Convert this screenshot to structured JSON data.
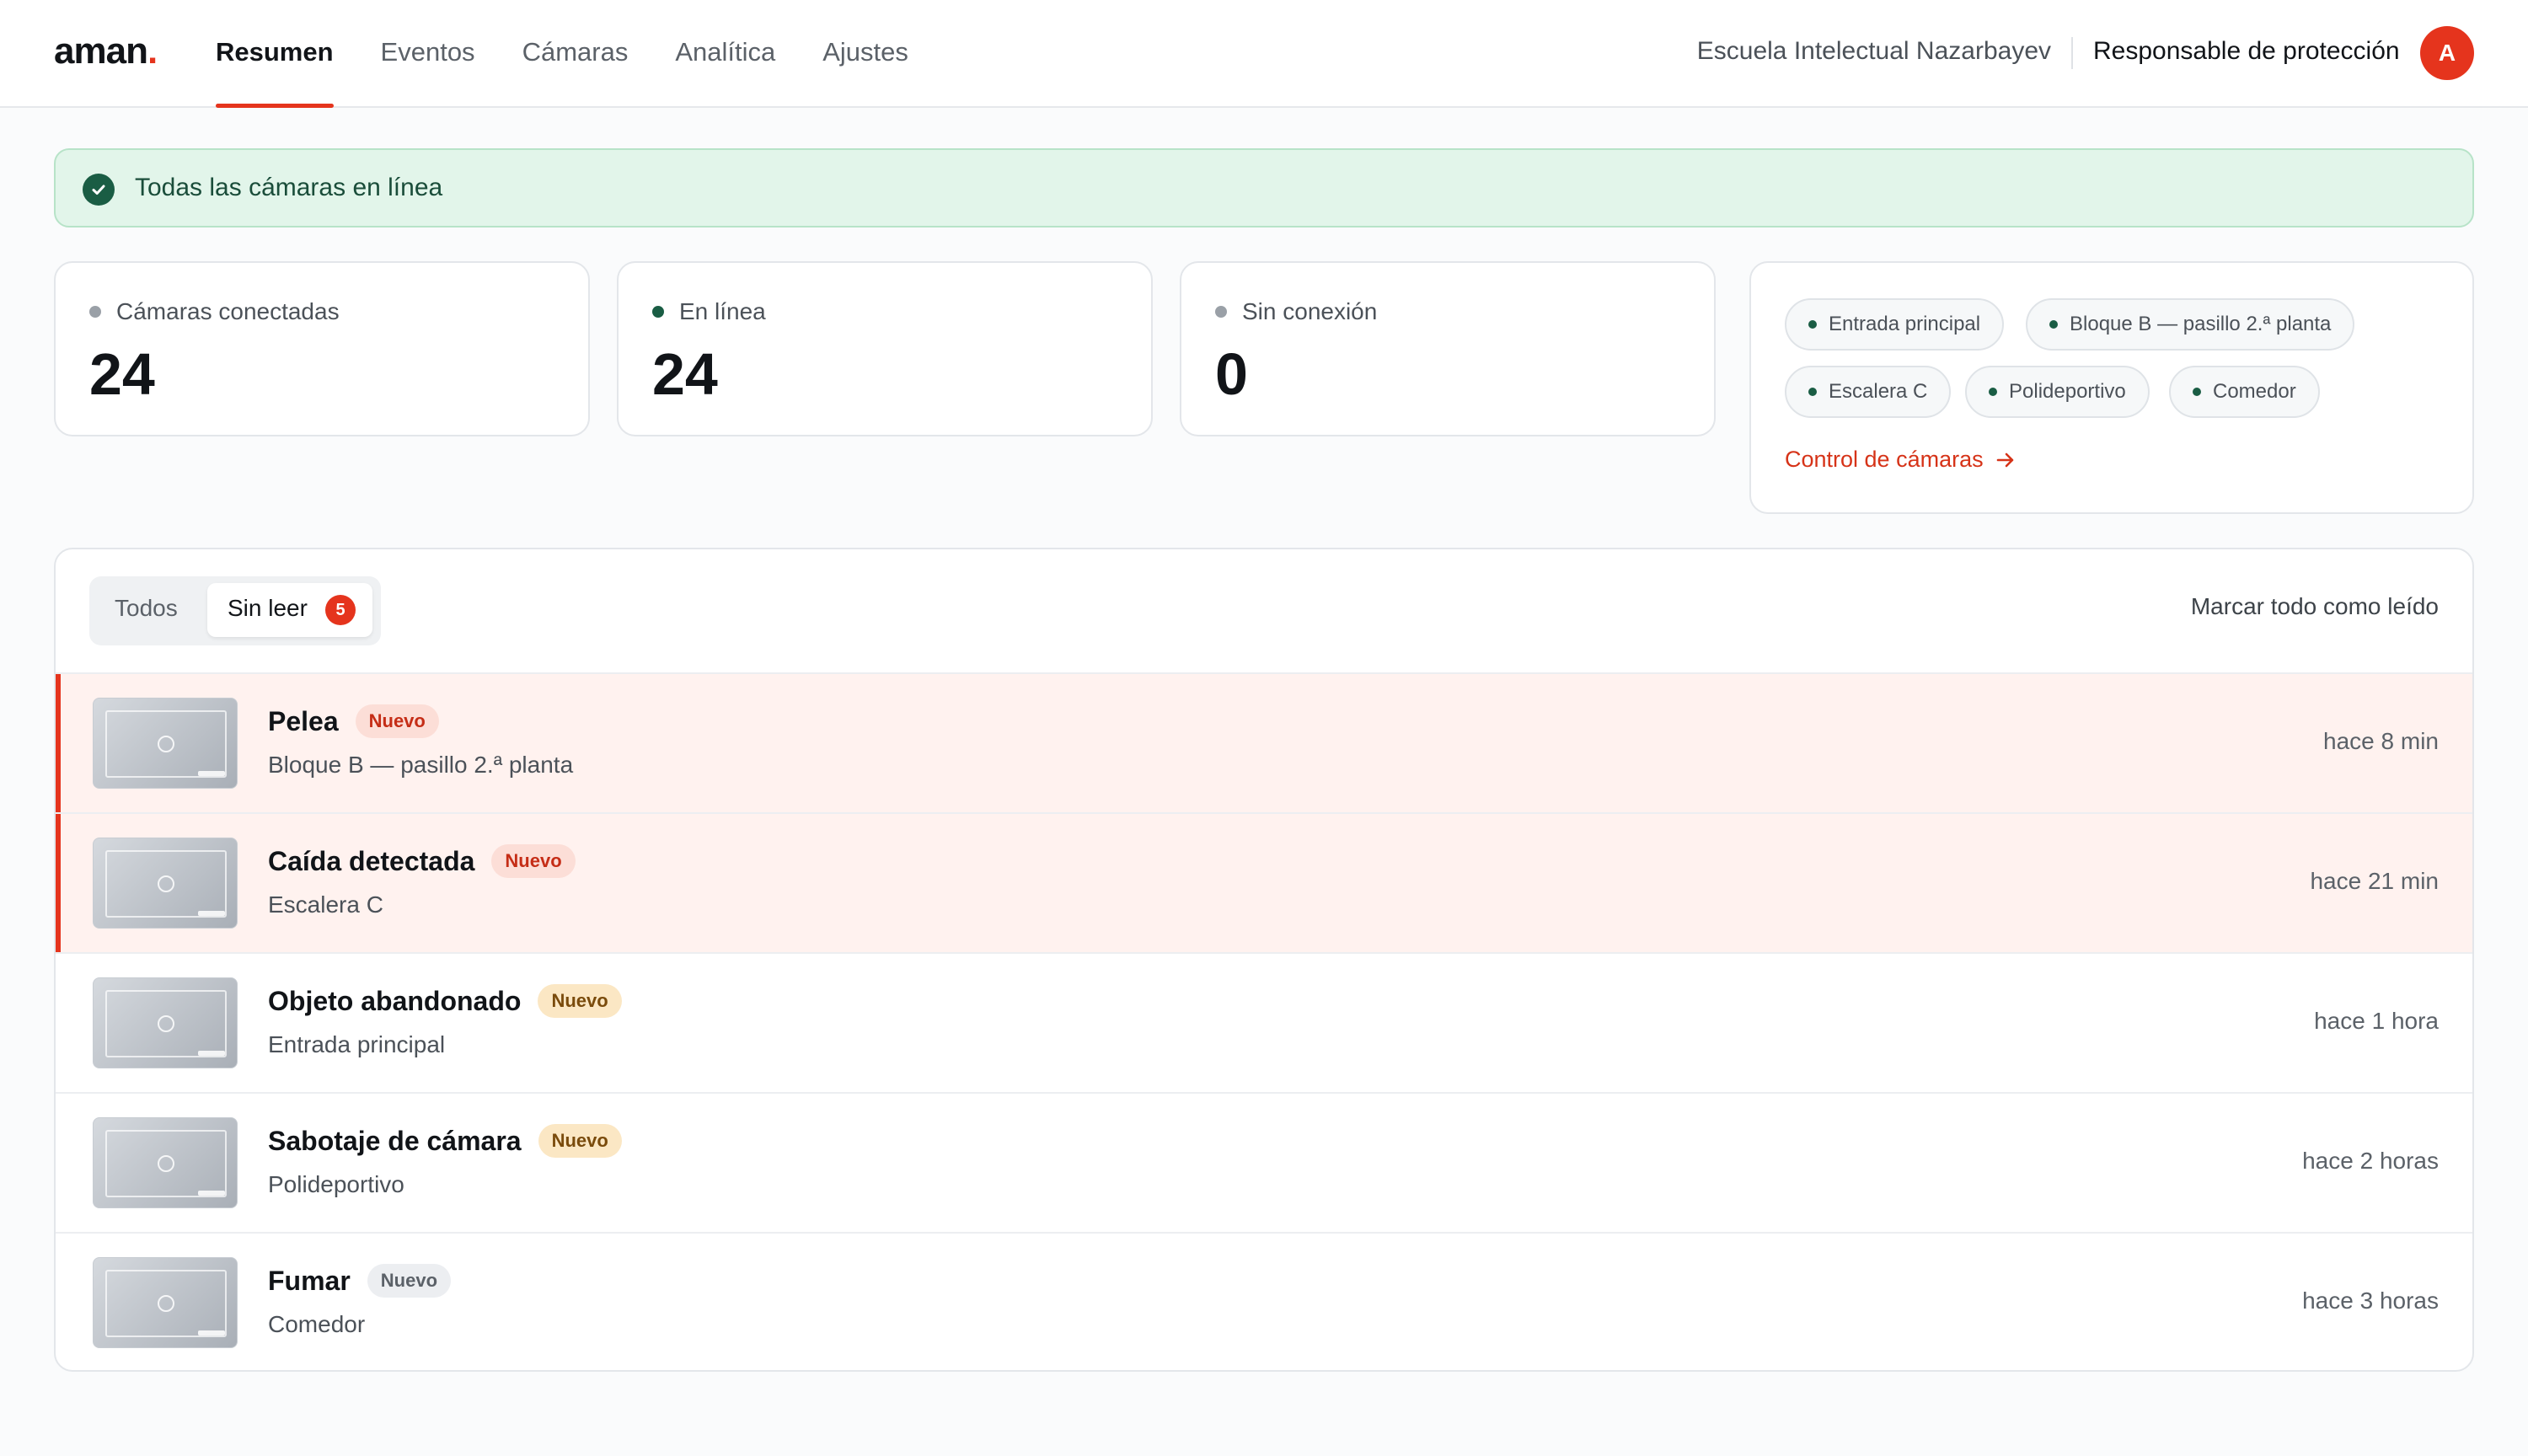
{
  "header": {
    "logo": "aman",
    "logo_dot": ".",
    "nav": [
      "Resumen",
      "Eventos",
      "Cámaras",
      "Analítica",
      "Ajustes"
    ],
    "active_nav": "Resumen",
    "organization": "Escuela Intelectual Nazarbayev",
    "role": "Responsable de protección",
    "avatar_letter": "A"
  },
  "banner": {
    "text": "Todas las cámaras en línea"
  },
  "stats": [
    {
      "label": "Cámaras conectadas",
      "value": "24",
      "dot_color": "#9aa0a7"
    },
    {
      "label": "En línea",
      "value": "24",
      "dot_color": "#1a5d44"
    },
    {
      "label": "Sin conexión",
      "value": "0",
      "dot_color": "#9aa0a7"
    }
  ],
  "cameras": {
    "chips": [
      "Entrada principal",
      "Bloque B — pasillo 2.ª planta",
      "Escalera C",
      "Polideportivo",
      "Comedor"
    ],
    "link": "Control de cámaras"
  },
  "events": {
    "tab_all": "Todos",
    "tab_unread": "Sin leer",
    "unread_count": "5",
    "mark_all": "Marcar todo como leído",
    "items": [
      {
        "title": "Pelea",
        "tag": "Nuevo",
        "tag_style": "red",
        "location": "Bloque B — pasillo 2.ª planta",
        "time": "hace 8 min",
        "highlight": true
      },
      {
        "title": "Caída detectada",
        "tag": "Nuevo",
        "tag_style": "red",
        "location": "Escalera C",
        "time": "hace 21 min",
        "highlight": true
      },
      {
        "title": "Objeto abandonado",
        "tag": "Nuevo",
        "tag_style": "amber",
        "location": "Entrada principal",
        "time": "hace 1 hora",
        "highlight": false
      },
      {
        "title": "Sabotaje de cámara",
        "tag": "Nuevo",
        "tag_style": "amber",
        "location": "Polideportivo",
        "time": "hace 2 horas",
        "highlight": false
      },
      {
        "title": "Fumar",
        "tag": "Nuevo",
        "tag_style": "gray",
        "location": "Comedor",
        "time": "hace 3 horas",
        "highlight": false
      }
    ]
  },
  "colors": {
    "accent": "#e5341d",
    "success": "#1a5d44",
    "banner_bg": "#e2f5ea"
  }
}
